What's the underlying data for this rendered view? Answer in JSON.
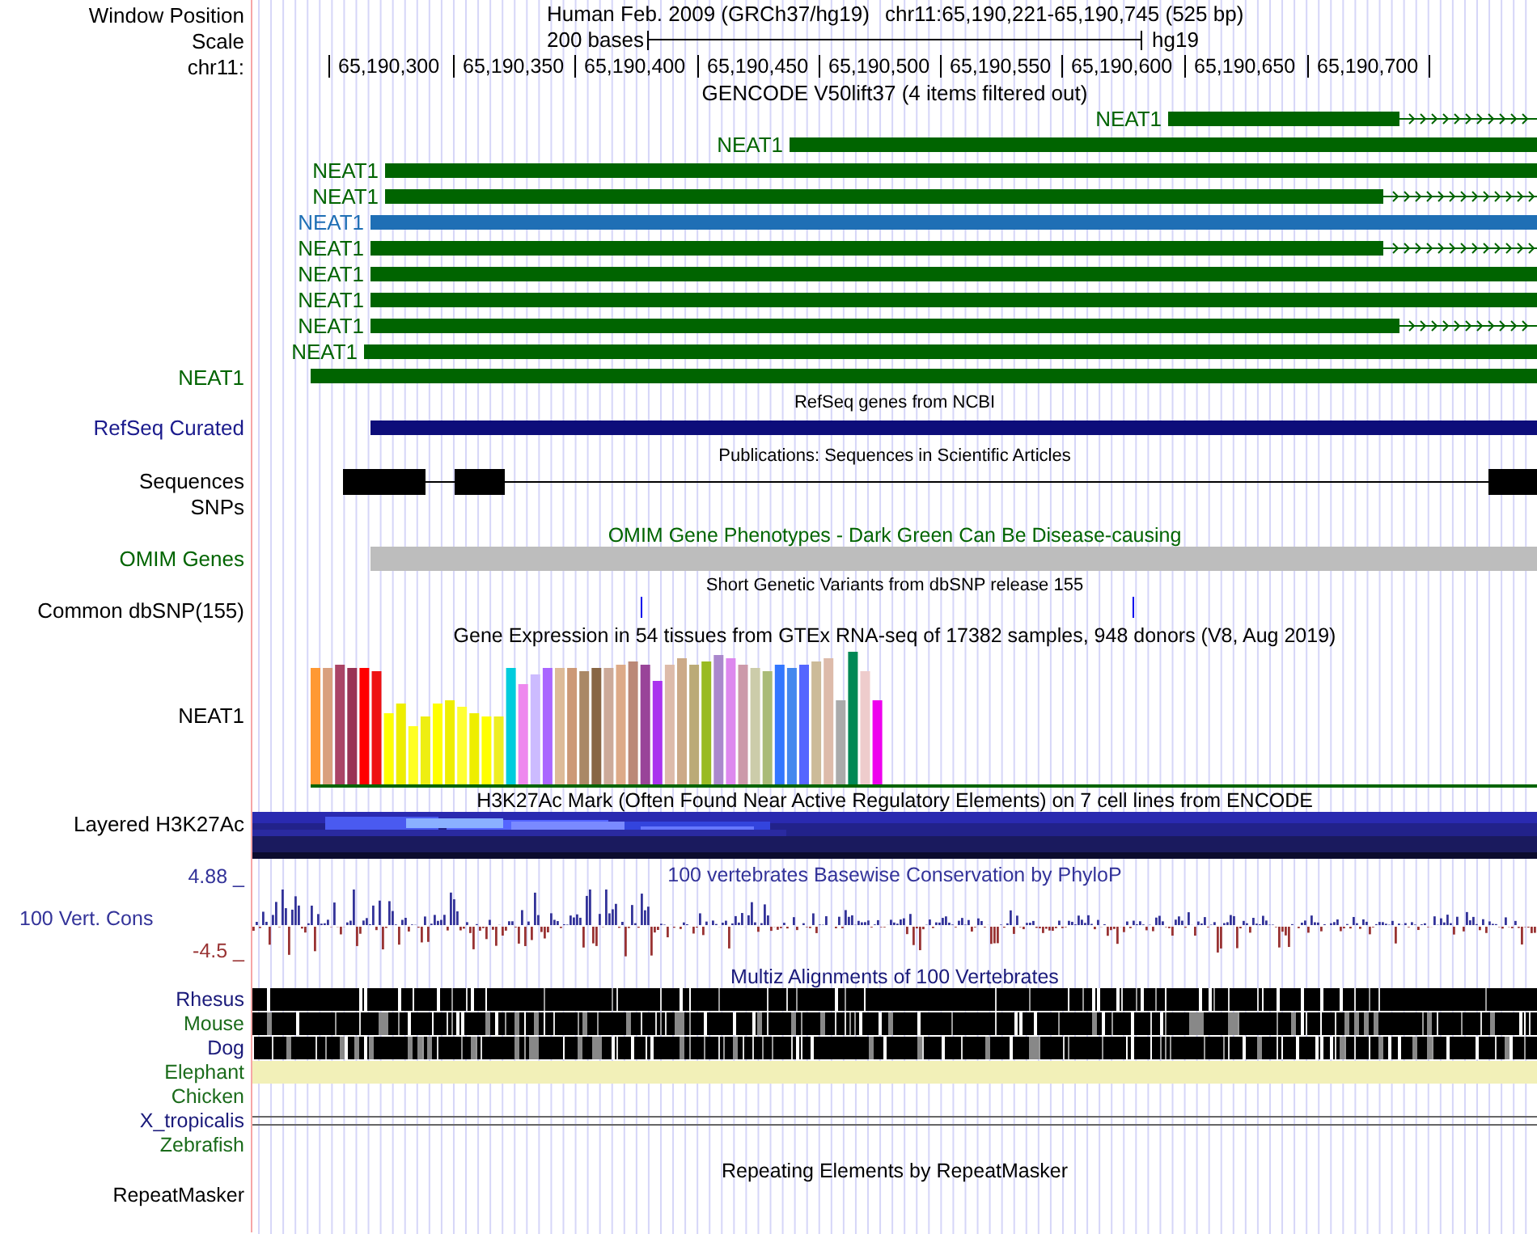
{
  "position": {
    "label": "Window Position",
    "assembly": "Human Feb. 2009 (GRCh37/hg19)",
    "range": "chr11:65,190,221-65,190,745 (525 bp)"
  },
  "scale": {
    "label": "Scale",
    "length": "200 bases",
    "database": "hg19"
  },
  "ruler": {
    "label": "chr11:",
    "ticks": [
      "65,190,300",
      "65,190,350",
      "65,190,400",
      "65,190,450",
      "65,190,500",
      "65,190,550",
      "65,190,600",
      "65,190,650",
      "65,190,700"
    ]
  },
  "gencode": {
    "title": "GENCODE V50lift37 (4 items filtered out)",
    "transcripts": [
      {
        "name": "NEAT1",
        "color": "#006400"
      },
      {
        "name": "NEAT1",
        "color": "#006400"
      },
      {
        "name": "NEAT1",
        "color": "#006400"
      },
      {
        "name": "NEAT1",
        "color": "#006400"
      },
      {
        "name": "NEAT1",
        "color": "#1f6fb5"
      },
      {
        "name": "NEAT1",
        "color": "#006400"
      },
      {
        "name": "NEAT1",
        "color": "#006400"
      },
      {
        "name": "NEAT1",
        "color": "#006400"
      },
      {
        "name": "NEAT1",
        "color": "#006400"
      },
      {
        "name": "NEAT1",
        "color": "#006400"
      }
    ],
    "track_label": "NEAT1"
  },
  "refseq": {
    "title": "RefSeq genes from NCBI",
    "label": "RefSeq Curated"
  },
  "publications": {
    "title": "Publications: Sequences in Scientific Articles",
    "labels": [
      "Sequences",
      "SNPs"
    ]
  },
  "omim": {
    "title": "OMIM Gene Phenotypes - Dark Green Can Be Disease-causing",
    "label": "OMIM Genes"
  },
  "dbsnp": {
    "title": "Short Genetic Variants from dbSNP release 155",
    "label": "Common dbSNP(155)"
  },
  "gtex": {
    "title": "Gene Expression in 54 tissues from GTEx RNA-seq of 17382 samples, 948 donors (V8, Aug 2019)",
    "label": "NEAT1"
  },
  "h3k27ac": {
    "title": "H3K27Ac Mark (Often Found Near Active Regulatory Elements) on 7 cell lines from ENCODE",
    "label": "Layered H3K27Ac"
  },
  "conservation": {
    "title": "100 vertebrates Basewise Conservation by PhyloP",
    "label": "100 Vert. Cons",
    "max": "4.88 _",
    "min": "-4.5 _"
  },
  "multiz": {
    "title": "Multiz Alignments of 100 Vertebrates",
    "species": [
      {
        "name": "Rhesus",
        "color": "#1a1a7a",
        "kind": "blocks"
      },
      {
        "name": "Mouse",
        "color": "#1a6b1a",
        "kind": "blocks"
      },
      {
        "name": "Dog",
        "color": "#1a1a7a",
        "kind": "blocks"
      },
      {
        "name": "Elephant",
        "color": "#1a6b1a",
        "kind": "fill"
      },
      {
        "name": "Chicken",
        "color": "#1a6b1a",
        "kind": "none"
      },
      {
        "name": "X_tropicalis",
        "color": "#1a1a7a",
        "kind": "double-line"
      },
      {
        "name": "Zebrafish",
        "color": "#1a6b1a",
        "kind": "none"
      }
    ]
  },
  "repeatmasker": {
    "title": "Repeating Elements by RepeatMasker",
    "label": "RepeatMasker"
  }
}
